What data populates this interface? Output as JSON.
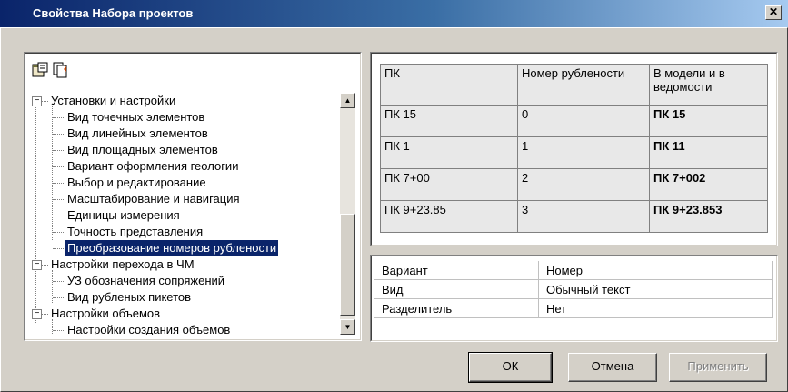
{
  "window": {
    "title": "Свойства Набора проектов",
    "close_glyph": "✕"
  },
  "toolbar": {
    "icons": [
      "properties-icon",
      "copy-icon"
    ]
  },
  "tree": {
    "items": [
      {
        "label": "Установки и настройки",
        "level": 0,
        "expanded": true
      },
      {
        "label": "Вид точечных элементов",
        "level": 1
      },
      {
        "label": "Вид линейных элементов",
        "level": 1
      },
      {
        "label": "Вид площадных элементов",
        "level": 1
      },
      {
        "label": "Вариант оформления геологии",
        "level": 1
      },
      {
        "label": "Выбор и редактирование",
        "level": 1
      },
      {
        "label": "Масштабирование и навигация",
        "level": 1
      },
      {
        "label": "Единицы измерения",
        "level": 1
      },
      {
        "label": "Точность представления",
        "level": 1
      },
      {
        "label": "Преобразование номеров рублености",
        "level": 1,
        "selected": true
      },
      {
        "label": "Настройки перехода в ЧМ",
        "level": 0,
        "expanded": true
      },
      {
        "label": "УЗ обозначения сопряжений",
        "level": 1
      },
      {
        "label": "Вид рубленых пикетов",
        "level": 1
      },
      {
        "label": "Настройки объемов",
        "level": 0,
        "expanded": true
      },
      {
        "label": "Настройки создания объемов",
        "level": 1
      }
    ]
  },
  "grid": {
    "headers": [
      "ПК",
      "Номер рублености",
      "В модели и в ведомости"
    ],
    "rows": [
      [
        "ПК 15",
        "0",
        "ПК 15"
      ],
      [
        "ПК 1",
        "1",
        "ПК 11"
      ],
      [
        "ПК 7+00",
        "2",
        "ПК 7+002"
      ],
      [
        "ПК 9+23.85",
        "3",
        "ПК 9+23.853"
      ]
    ]
  },
  "properties": {
    "rows": [
      {
        "name": "Вариант",
        "value": "Номер"
      },
      {
        "name": "Вид",
        "value": "Обычный текст"
      },
      {
        "name": "Разделитель",
        "value": "Нет"
      }
    ]
  },
  "buttons": {
    "ok": "ОК",
    "cancel": "Отмена",
    "apply": "Применить"
  },
  "scrollbar": {
    "up_glyph": "▲",
    "down_glyph": "▼"
  }
}
